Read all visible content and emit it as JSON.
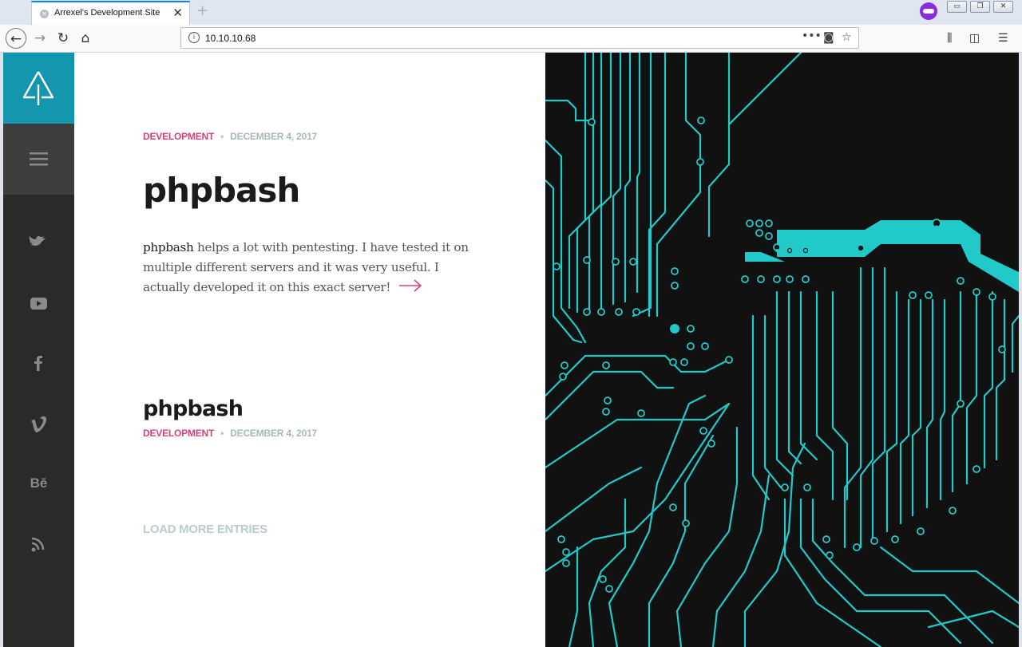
{
  "browser": {
    "tab_title": "Arrexel's Development Site",
    "tab_close": "✕",
    "new_tab": "+",
    "url": "10.10.10.68",
    "window_buttons": [
      "▭",
      "❐",
      "✕"
    ]
  },
  "sidebar": {
    "icons": [
      "tree-icon",
      "menu-icon",
      "twitter-icon",
      "youtube-icon",
      "facebook-icon",
      "vimeo-icon",
      "behance-icon",
      "rss-icon"
    ]
  },
  "posts": [
    {
      "category": "DEVELOPMENT",
      "date": "DECEMBER 4, 2017",
      "title": "phpbash",
      "excerpt_lead": "phpbash",
      "excerpt_rest": " helps a lot with pentesting. I have tested it on multiple different servers and it was very useful. I actually developed it on this exact server!"
    },
    {
      "category": "DEVELOPMENT",
      "date": "DECEMBER 4, 2017",
      "title": "phpbash"
    }
  ],
  "load_more": "LOAD MORE ENTRIES",
  "colors": {
    "accent": "#1497ae",
    "category": "#d4427e",
    "circuit": "#22c9c9",
    "hero_bg": "#111111",
    "sidebar_bg": "#2a2a2a"
  }
}
